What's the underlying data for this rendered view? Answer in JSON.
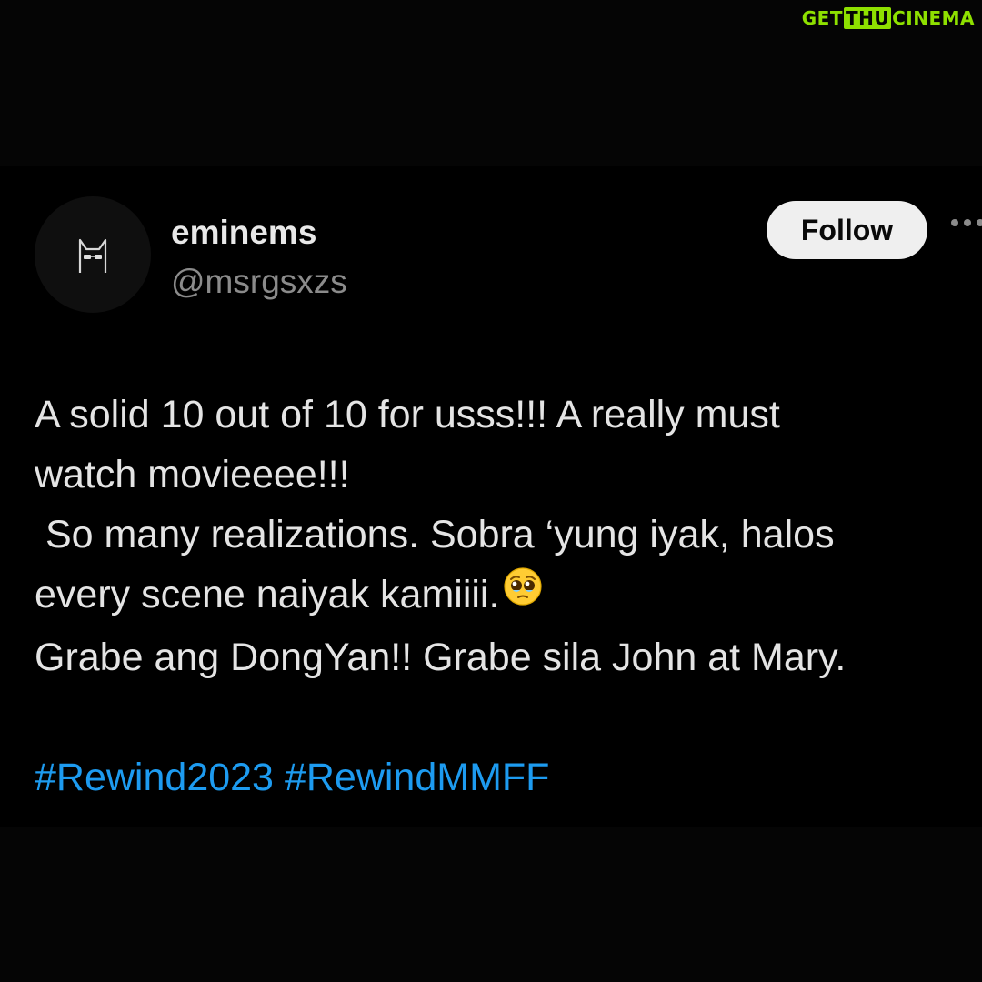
{
  "watermark": {
    "part_a": "GET",
    "part_b": "THU",
    "part_c": "CINEMA"
  },
  "tweet": {
    "display_name": "eminems",
    "handle": "@msrgsxzs",
    "follow_label": "Follow",
    "more_icon": "more-horizontal-icon",
    "avatar_icon": "cat-sunglasses-avatar",
    "lines": [
      "A solid 10 out of 10 for usss!!! A really must",
      "watch movieeee!!!",
      " So many realizations. Sobra ‘yung iyak, halos",
      "every scene naiyak kamiiii.",
      "Grabe ang DongYan!! Grabe sila John at Mary."
    ],
    "emoji": "pleading-face-emoji",
    "hashtags": [
      "#Rewind2023",
      "#RewindMMFF"
    ]
  },
  "colors": {
    "background": "#050505",
    "card": "#000000",
    "text": "#e4e4e4",
    "muted": "#8b8b8b",
    "link": "#1d9bf0",
    "follow_bg": "#efefef",
    "watermark": "#8ee000"
  }
}
